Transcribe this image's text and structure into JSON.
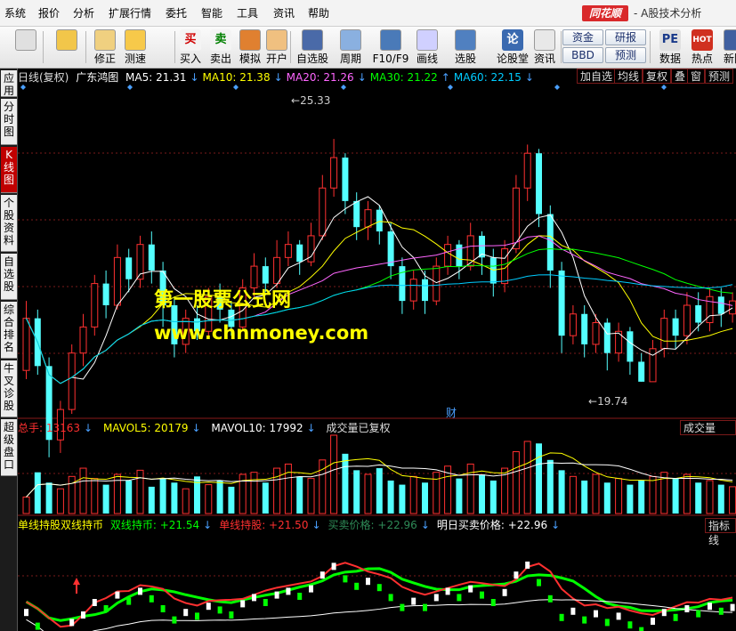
{
  "menu": [
    "系统",
    "报价",
    "分析",
    "扩展行情",
    "委托",
    "智能",
    "工具",
    "资讯",
    "帮助"
  ],
  "brand": "同花顺",
  "app_title": "- A股技术分析",
  "toolbar": {
    "buttons": [
      {
        "label": "",
        "icon": "grid-icon"
      },
      {
        "label": "",
        "icon": "back-arrow-icon"
      },
      {
        "label": "修正",
        "icon": "up-down-arrows-icon"
      },
      {
        "label": "测速",
        "icon": "clock-icon"
      },
      {
        "label": "买入",
        "icon": "buy-icon",
        "glyph": "买"
      },
      {
        "label": "卖出",
        "icon": "sell-icon",
        "glyph": "卖"
      },
      {
        "label": "模拟",
        "icon": "hammer-icon"
      },
      {
        "label": "开户",
        "icon": "lock-icon"
      },
      {
        "label": "自选股",
        "icon": "star-icon"
      },
      {
        "label": "周期",
        "icon": "cycle-icon"
      },
      {
        "label": "F10/F9",
        "icon": "f10-icon"
      },
      {
        "label": "画线",
        "icon": "pencil-icon"
      },
      {
        "label": "选股",
        "icon": "screen-icon"
      },
      {
        "label": "论股堂",
        "icon": "forum-icon",
        "glyph": "论"
      },
      {
        "label": "资讯",
        "icon": "document-icon"
      },
      {
        "label": "数据",
        "icon": "pe-icon",
        "glyph": "PE"
      },
      {
        "label": "热点",
        "icon": "hot-icon",
        "glyph": "HOT"
      },
      {
        "label": "新阶",
        "icon": "new-icon"
      }
    ],
    "indicators": [
      "资金",
      "研报",
      "BBD",
      "预测"
    ]
  },
  "side_tabs": [
    "应用",
    "分时图",
    "K线图",
    "个股资料",
    "自选股",
    "综合排名",
    "牛叉诊股",
    "超级盘口"
  ],
  "active_side_tab": 2,
  "kline_header": {
    "period": "日线(复权)",
    "stock": "广东鸿图",
    "ma": [
      {
        "label": "MA5: 21.31",
        "arrow": "↓",
        "color": "#ffffff"
      },
      {
        "label": "MA10: 21.38",
        "arrow": "↓",
        "color": "#ffff00"
      },
      {
        "label": "MA20: 21.26",
        "arrow": "↓",
        "color": "#ff66ff"
      },
      {
        "label": "MA30: 21.22",
        "arrow": "↑",
        "color": "#00ff00"
      },
      {
        "label": "MA60: 22.15",
        "arrow": "↓",
        "color": "#00ccff"
      }
    ],
    "right_buttons": [
      "加自选",
      "均线",
      "复权",
      "叠",
      "窗",
      "预测"
    ]
  },
  "price_markers": {
    "high": "25.33",
    "low": "19.74",
    "event": "财"
  },
  "watermark": {
    "line1": "第一股票公式网",
    "line2": "www.chnmoney.com"
  },
  "volume_header": {
    "total": "总手: 13163",
    "total_arrow": "↓",
    "mavol5": "MAVOL5: 20179",
    "mavol5_arrow": "↓",
    "mavol10": "MAVOL10: 17992",
    "mavol10_arrow": "↓",
    "note": "成交量已复权",
    "right": "成交量"
  },
  "indicator_header": {
    "name": "单线持股双线持币",
    "items": [
      {
        "label": "双线持币: +21.54",
        "arrow": "↓",
        "color": "#00ff00"
      },
      {
        "label": "单线持股: +21.50",
        "arrow": "↓",
        "color": "#ff3030"
      },
      {
        "label": "买卖价格: +22.96",
        "arrow": "↓",
        "color": "#2e8b57"
      },
      {
        "label": "明日买卖价格: +22.96",
        "arrow": "↓",
        "color": "#ffffff"
      }
    ],
    "right": "指标线"
  },
  "colors": {
    "up": "#ff3030",
    "down": "#54ffff",
    "bg": "#000000",
    "grid": "#7a1a1a"
  },
  "chart_data": {
    "type": "candlestick",
    "candles": [
      [
        20.0,
        21.2,
        21.6,
        19.8
      ],
      [
        21.2,
        20.1,
        21.4,
        19.9
      ],
      [
        20.1,
        18.4,
        20.3,
        18.0
      ],
      [
        18.4,
        19.1,
        19.3,
        18.1
      ],
      [
        19.1,
        20.4,
        20.6,
        19.0
      ],
      [
        20.4,
        21.0,
        21.3,
        20.1
      ],
      [
        21.0,
        22.0,
        22.2,
        20.8
      ],
      [
        22.0,
        21.5,
        22.3,
        21.2
      ],
      [
        21.5,
        22.6,
        22.9,
        21.4
      ],
      [
        22.6,
        22.1,
        22.8,
        21.8
      ],
      [
        22.1,
        22.9,
        23.1,
        21.9
      ],
      [
        22.9,
        22.3,
        23.2,
        22.0
      ],
      [
        22.3,
        21.5,
        22.5,
        21.0
      ],
      [
        21.5,
        20.6,
        21.7,
        20.3
      ],
      [
        20.6,
        21.2,
        21.4,
        20.4
      ],
      [
        21.2,
        20.9,
        21.5,
        20.7
      ],
      [
        20.9,
        21.7,
        21.9,
        20.8
      ],
      [
        21.7,
        21.4,
        22.0,
        21.1
      ],
      [
        21.4,
        21.0,
        21.6,
        20.8
      ],
      [
        21.0,
        21.9,
        22.1,
        20.9
      ],
      [
        21.9,
        22.4,
        22.7,
        21.7
      ],
      [
        22.4,
        22.0,
        22.6,
        21.8
      ],
      [
        22.0,
        22.6,
        23.0,
        21.9
      ],
      [
        22.6,
        22.9,
        23.2,
        22.4
      ],
      [
        22.9,
        22.5,
        23.0,
        22.2
      ],
      [
        22.5,
        23.1,
        23.4,
        22.4
      ],
      [
        23.1,
        24.2,
        24.5,
        23.0
      ],
      [
        24.2,
        24.9,
        25.33,
        24.0
      ],
      [
        24.9,
        23.9,
        25.0,
        23.6
      ],
      [
        23.9,
        23.3,
        24.1,
        23.0
      ],
      [
        23.3,
        23.7,
        23.9,
        23.0
      ],
      [
        23.7,
        23.2,
        23.8,
        22.9
      ],
      [
        23.2,
        22.4,
        23.4,
        22.1
      ],
      [
        22.4,
        21.6,
        22.6,
        21.3
      ],
      [
        21.6,
        22.1,
        22.3,
        21.4
      ],
      [
        22.1,
        21.6,
        22.3,
        21.3
      ],
      [
        21.6,
        22.4,
        22.6,
        21.5
      ],
      [
        22.4,
        22.9,
        23.1,
        22.2
      ],
      [
        22.9,
        22.4,
        23.0,
        22.1
      ],
      [
        22.4,
        23.1,
        23.4,
        22.3
      ],
      [
        23.1,
        22.6,
        23.2,
        22.2
      ],
      [
        22.6,
        22.0,
        22.8,
        21.7
      ],
      [
        22.0,
        22.8,
        23.0,
        21.8
      ],
      [
        22.8,
        24.2,
        24.5,
        22.7
      ],
      [
        24.2,
        25.0,
        25.2,
        23.9
      ],
      [
        25.0,
        23.6,
        25.1,
        23.3
      ],
      [
        23.6,
        22.3,
        23.8,
        21.9
      ],
      [
        22.3,
        20.8,
        22.5,
        20.4
      ],
      [
        20.8,
        21.3,
        21.5,
        20.6
      ],
      [
        21.3,
        20.6,
        21.5,
        20.3
      ],
      [
        20.6,
        21.1,
        21.3,
        20.4
      ],
      [
        21.1,
        20.4,
        21.2,
        20.0
      ],
      [
        20.4,
        20.9,
        21.1,
        20.2
      ],
      [
        20.9,
        20.2,
        21.0,
        19.9
      ],
      [
        20.2,
        19.74,
        20.4,
        19.74
      ],
      [
        19.74,
        20.5,
        20.7,
        19.8
      ],
      [
        20.5,
        21.2,
        21.4,
        20.3
      ],
      [
        21.2,
        20.8,
        21.4,
        20.5
      ],
      [
        20.8,
        21.5,
        21.8,
        20.6
      ],
      [
        21.5,
        21.1,
        21.8,
        20.9
      ],
      [
        21.1,
        21.7,
        21.9,
        20.9
      ],
      [
        21.7,
        21.3,
        21.9,
        21.0
      ],
      [
        21.3,
        21.6,
        21.8,
        21.1
      ]
    ],
    "volume": [
      8,
      20,
      15,
      12,
      18,
      22,
      17,
      14,
      19,
      16,
      21,
      13,
      17,
      15,
      12,
      18,
      14,
      16,
      13,
      19,
      20,
      15,
      22,
      24,
      18,
      17,
      26,
      38,
      29,
      21,
      19,
      22,
      16,
      14,
      18,
      15,
      20,
      23,
      17,
      24,
      19,
      16,
      22,
      30,
      35,
      34,
      26,
      21,
      18,
      16,
      19,
      15,
      17,
      14,
      16,
      18,
      20,
      17,
      19,
      15,
      16,
      14,
      13
    ],
    "ma_series": [
      "MA5",
      "MA10",
      "MA20",
      "MA30",
      "MA60"
    ],
    "ylim": [
      19.0,
      26.5
    ]
  }
}
